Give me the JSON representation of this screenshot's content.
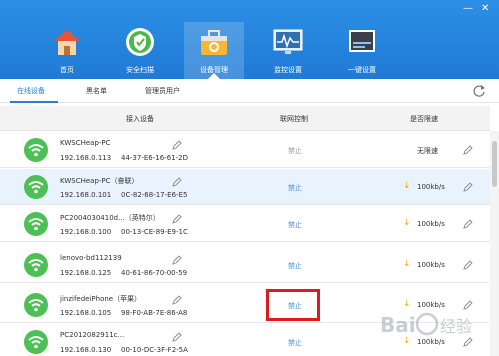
{
  "window": {
    "minimize": "—",
    "close": "✕"
  },
  "nav": [
    {
      "label": "首页",
      "icon": "house-icon"
    },
    {
      "label": "安全扫描",
      "icon": "shield-icon"
    },
    {
      "label": "设备管理",
      "icon": "toolbox-icon"
    },
    {
      "label": "监控设置",
      "icon": "monitor-icon"
    },
    {
      "label": "一键设置",
      "icon": "router-icon"
    }
  ],
  "tabs": [
    {
      "label": "在线设备"
    },
    {
      "label": "黑名单"
    },
    {
      "label": "管理员用户"
    }
  ],
  "table": {
    "headers": [
      "接入设备",
      "联网控制",
      "是否限速"
    ],
    "rows": [
      {
        "name": "KWSCHeap-PC",
        "ip": "192.168.0.113",
        "mac": "44-37-E6-16-61-2D",
        "control": "禁止",
        "limit": "无限速",
        "has_arrow": false
      },
      {
        "name": "KWSCHeap-PC（奋联）",
        "ip": "192.168.0.101",
        "mac": "0C-82-68-17-E6-E5",
        "control": "禁止",
        "limit": "100kb/s",
        "has_arrow": true
      },
      {
        "name": "PC2004030410d...（英特尔）",
        "ip": "192.168.0.100",
        "mac": "00-13-CE-89-E9-1C",
        "control": "禁止",
        "limit": "100kb/s",
        "has_arrow": true
      },
      {
        "name": "lenovo-bd112139",
        "ip": "192.168.0.125",
        "mac": "40-61-86-70-00-59",
        "control": "禁止",
        "limit": "100kb/s",
        "has_arrow": true
      },
      {
        "name": "jinzifedeiPhone（苹果）",
        "ip": "192.168.0.105",
        "mac": "98-F0-AB-7E-86-A8",
        "control": "禁止",
        "limit": "100kb/s",
        "has_arrow": true
      },
      {
        "name": "PC2012082911c...",
        "ip": "192.168.0.130",
        "mac": "00-10-DC-3F-F2-5A",
        "control": "禁止",
        "limit": "100kb/s",
        "has_arrow": true
      }
    ]
  },
  "colors": {
    "header": "#2283dc",
    "accent": "#2a7fd4",
    "wifi": "#4cc054",
    "highlight_box": "#e0191e"
  },
  "watermark": "Baidu经验"
}
